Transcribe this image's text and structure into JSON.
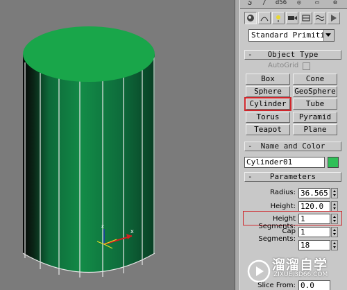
{
  "viewport": {
    "object_color": "#16924a",
    "top_color": "#19a64a"
  },
  "panel": {
    "tabs": [
      "ئ",
      "d56"
    ],
    "icons": [
      "geometry-icon",
      "shapes-icon",
      "lights-icon",
      "cameras-icon",
      "helpers-icon",
      "spacewarps-icon",
      "systems-icon"
    ],
    "category_dropdown": "Standard Primitiv",
    "object_type": {
      "title": "Object Type",
      "autogrid_label": "AutoGrid",
      "buttons": [
        {
          "label": "Box"
        },
        {
          "label": "Cone"
        },
        {
          "label": "Sphere"
        },
        {
          "label": "GeoSphere"
        },
        {
          "label": "Cylinder"
        },
        {
          "label": "Tube"
        },
        {
          "label": "Torus"
        },
        {
          "label": "Pyramid"
        },
        {
          "label": "Teapot"
        },
        {
          "label": "Plane"
        }
      ],
      "selected": "Cylinder"
    },
    "name_and_color": {
      "title": "Name and Color",
      "name": "Cylinder01",
      "color": "#2fbf57"
    },
    "parameters": {
      "title": "Parameters",
      "radius_label": "Radius:",
      "radius": "36.565",
      "height_label": "Height:",
      "height": "120.0",
      "height_segments_label": "Height Segments:",
      "height_segments": "1",
      "cap_segments_label": "Cap Segments:",
      "cap_segments": "1",
      "sides": "18",
      "slice_from_label": "Slice From:",
      "slice_from": "0.0"
    }
  },
  "watermark": {
    "title": "溜溜自学",
    "subtitle": "ZIXUE.3D66.COM"
  },
  "accent_red": "#d0262b"
}
